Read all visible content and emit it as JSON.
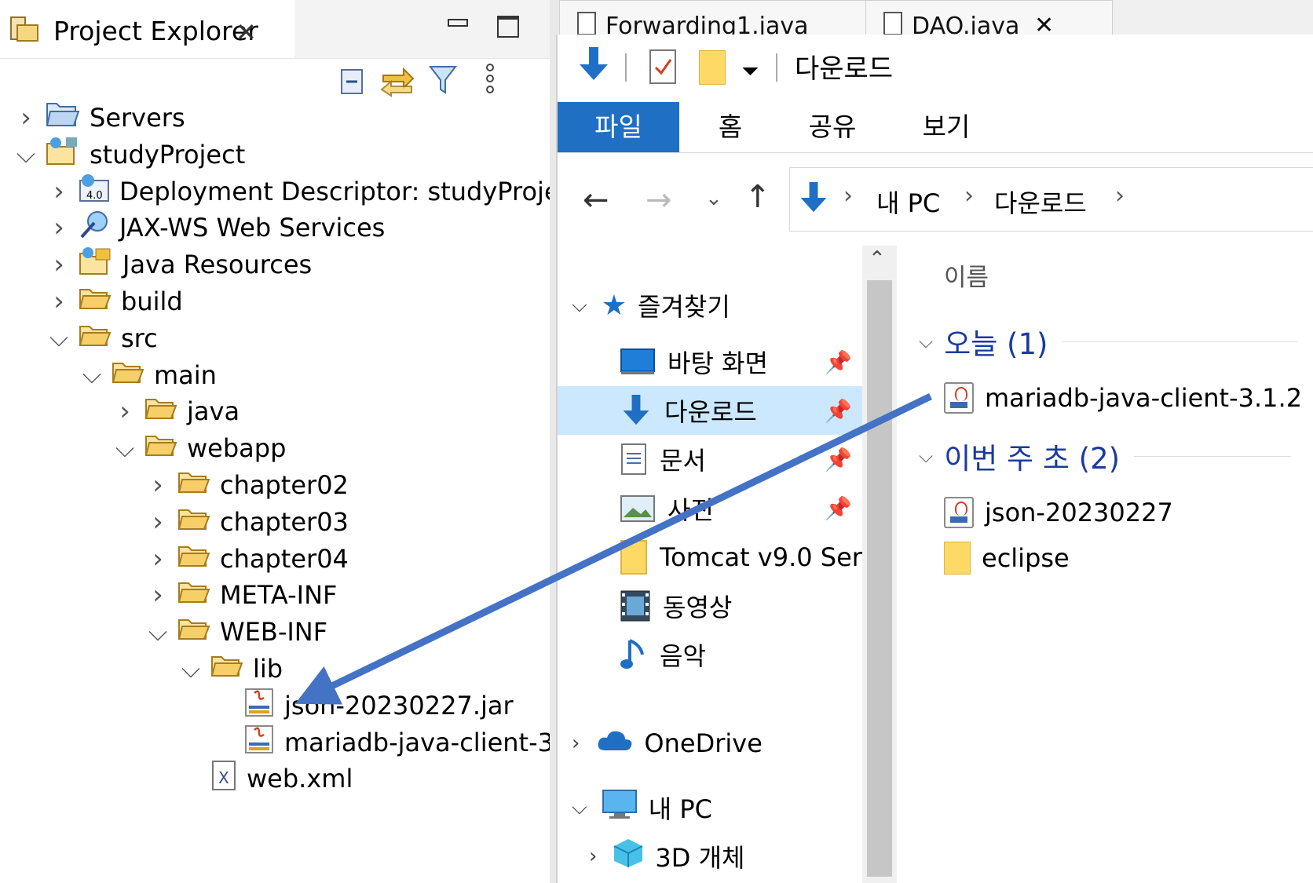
{
  "eclipse": {
    "view_title": "Project Explorer",
    "tree": [
      {
        "label": "Servers",
        "level": 0,
        "expanded": false,
        "icon": "servers-folder-icon"
      },
      {
        "label": "studyProject",
        "level": 0,
        "expanded": true,
        "icon": "web-project-icon"
      },
      {
        "label": "Deployment Descriptor: studyProject",
        "level": 1,
        "expanded": false,
        "icon": "deployment-descriptor-icon"
      },
      {
        "label": "JAX-WS Web Services",
        "level": 1,
        "expanded": false,
        "icon": "web-services-icon"
      },
      {
        "label": "Java Resources",
        "level": 1,
        "expanded": false,
        "icon": "java-resources-icon"
      },
      {
        "label": "build",
        "level": 1,
        "expanded": false,
        "icon": "folder-icon"
      },
      {
        "label": "src",
        "level": 1,
        "expanded": true,
        "icon": "folder-icon"
      },
      {
        "label": "main",
        "level": 2,
        "expanded": true,
        "icon": "folder-icon"
      },
      {
        "label": "java",
        "level": 3,
        "expanded": false,
        "icon": "folder-icon"
      },
      {
        "label": "webapp",
        "level": 3,
        "expanded": true,
        "icon": "folder-icon"
      },
      {
        "label": "chapter02",
        "level": 4,
        "expanded": false,
        "icon": "folder-icon"
      },
      {
        "label": "chapter03",
        "level": 4,
        "expanded": false,
        "icon": "folder-icon"
      },
      {
        "label": "chapter04",
        "level": 4,
        "expanded": false,
        "icon": "folder-icon"
      },
      {
        "label": "META-INF",
        "level": 4,
        "expanded": false,
        "icon": "folder-icon"
      },
      {
        "label": "WEB-INF",
        "level": 4,
        "expanded": true,
        "icon": "folder-icon"
      },
      {
        "label": "lib",
        "level": 5,
        "expanded": true,
        "icon": "folder-icon"
      },
      {
        "label": "json-20230227.jar",
        "level": 6,
        "expanded": null,
        "icon": "jar-icon"
      },
      {
        "label": "mariadb-java-client-3",
        "level": 6,
        "expanded": null,
        "icon": "jar-icon"
      },
      {
        "label": "web.xml",
        "level": 5,
        "expanded": null,
        "icon": "xml-file-icon"
      }
    ],
    "editor_tabs": [
      "Forwarding1.java",
      "DAO.java"
    ]
  },
  "explorer": {
    "window_title": "다운로드",
    "ribbon_tabs": [
      "파일",
      "홈",
      "공유",
      "보기"
    ],
    "breadcrumb": [
      "내 PC",
      "다운로드"
    ],
    "nav": {
      "quick_access": "즐겨찾기",
      "items": [
        {
          "label": "바탕 화면",
          "pinned": true,
          "icon": "desktop-icon"
        },
        {
          "label": "다운로드",
          "pinned": true,
          "icon": "downloads-icon",
          "selected": true
        },
        {
          "label": "문서",
          "pinned": true,
          "icon": "documents-icon"
        },
        {
          "label": "사진",
          "pinned": true,
          "icon": "pictures-icon"
        },
        {
          "label": "Tomcat v9.0 Ser",
          "pinned": false,
          "icon": "folder-icon"
        },
        {
          "label": "동영상",
          "pinned": false,
          "icon": "videos-icon"
        },
        {
          "label": "음악",
          "pinned": false,
          "icon": "music-icon"
        }
      ],
      "onedrive": "OneDrive",
      "this_pc": "내 PC",
      "objects_3d": "3D 개체"
    },
    "column_header": "이름",
    "groups": [
      {
        "label": "오늘 (1)",
        "files": [
          {
            "name": "mariadb-java-client-3.1.2",
            "icon": "jar-icon"
          }
        ]
      },
      {
        "label": "이번 주 초 (2)",
        "files": [
          {
            "name": "json-20230227",
            "icon": "jar-icon"
          },
          {
            "name": "eclipse",
            "icon": "folder-icon"
          }
        ]
      }
    ]
  },
  "colors": {
    "accent": "#1f6fc5",
    "arrow": "#4472c4",
    "selected_nav": "#cce8ff"
  }
}
